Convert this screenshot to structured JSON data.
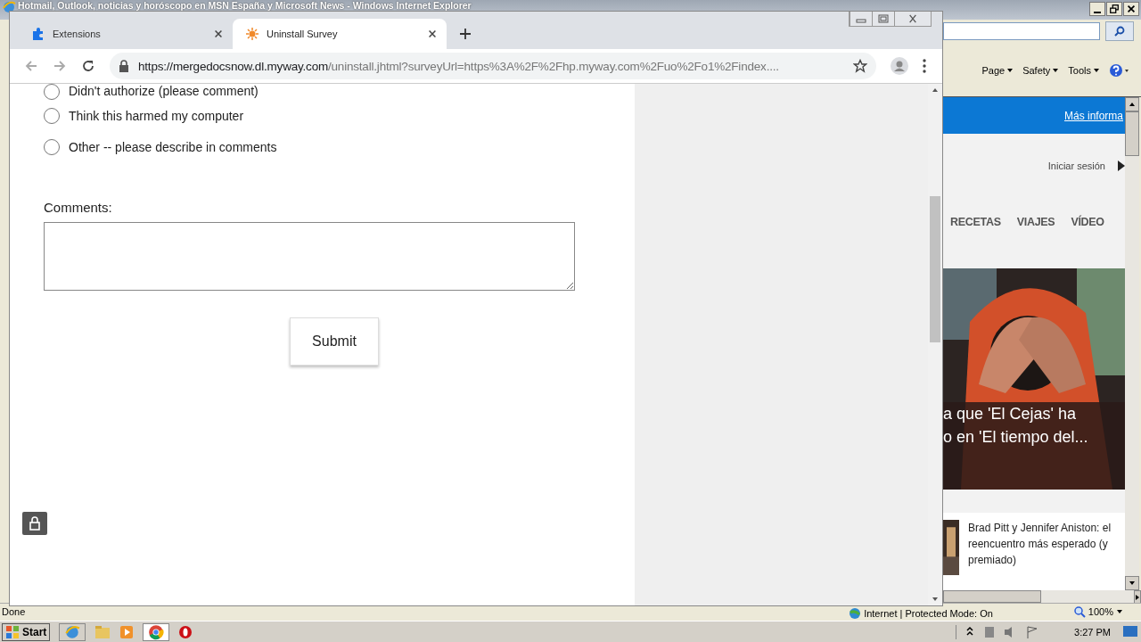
{
  "ie_window": {
    "title": "Hotmail, Outlook, noticias y horóscopo en MSN España y Microsoft News - Windows Internet Explorer",
    "toolbar": [
      {
        "label": "Page"
      },
      {
        "label": "Safety"
      },
      {
        "label": "Tools"
      }
    ],
    "banner_link": "Más informa",
    "sign_in": "Iniciar sesión",
    "nav": [
      "RECETAS",
      "VIAJES",
      "VÍDEO"
    ],
    "hero_caption": [
      "a que 'El Cejas' ha",
      "o en 'El tiempo del..."
    ],
    "news_item": "Brad Pitt y Jennifer Aniston: el reencuentro más esperado (y premiado)",
    "status": "Done",
    "zone": "Internet | Protected Mode: On",
    "zoom": "100%"
  },
  "chrome_window": {
    "tabs": [
      {
        "title": "Extensions",
        "selected": false
      },
      {
        "title": "Uninstall Survey",
        "selected": true
      }
    ],
    "url_host": "https://mergedocsnow.dl.myway.com",
    "url_path": "/uninstall.jhtml?surveyUrl=https%3A%2F%2Fhp.myway.com%2Fuo%2Fo1%2Findex....",
    "options": [
      {
        "label": "Didn't authorize (please comment)",
        "selected": false
      },
      {
        "label": "Think this harmed my computer",
        "selected": false
      },
      {
        "label": "Other -- please describe in comments",
        "selected": false
      }
    ],
    "comments_label": "Comments:",
    "submit": "Submit"
  },
  "taskbar": {
    "start": "Start",
    "clock": "3:27 PM"
  }
}
